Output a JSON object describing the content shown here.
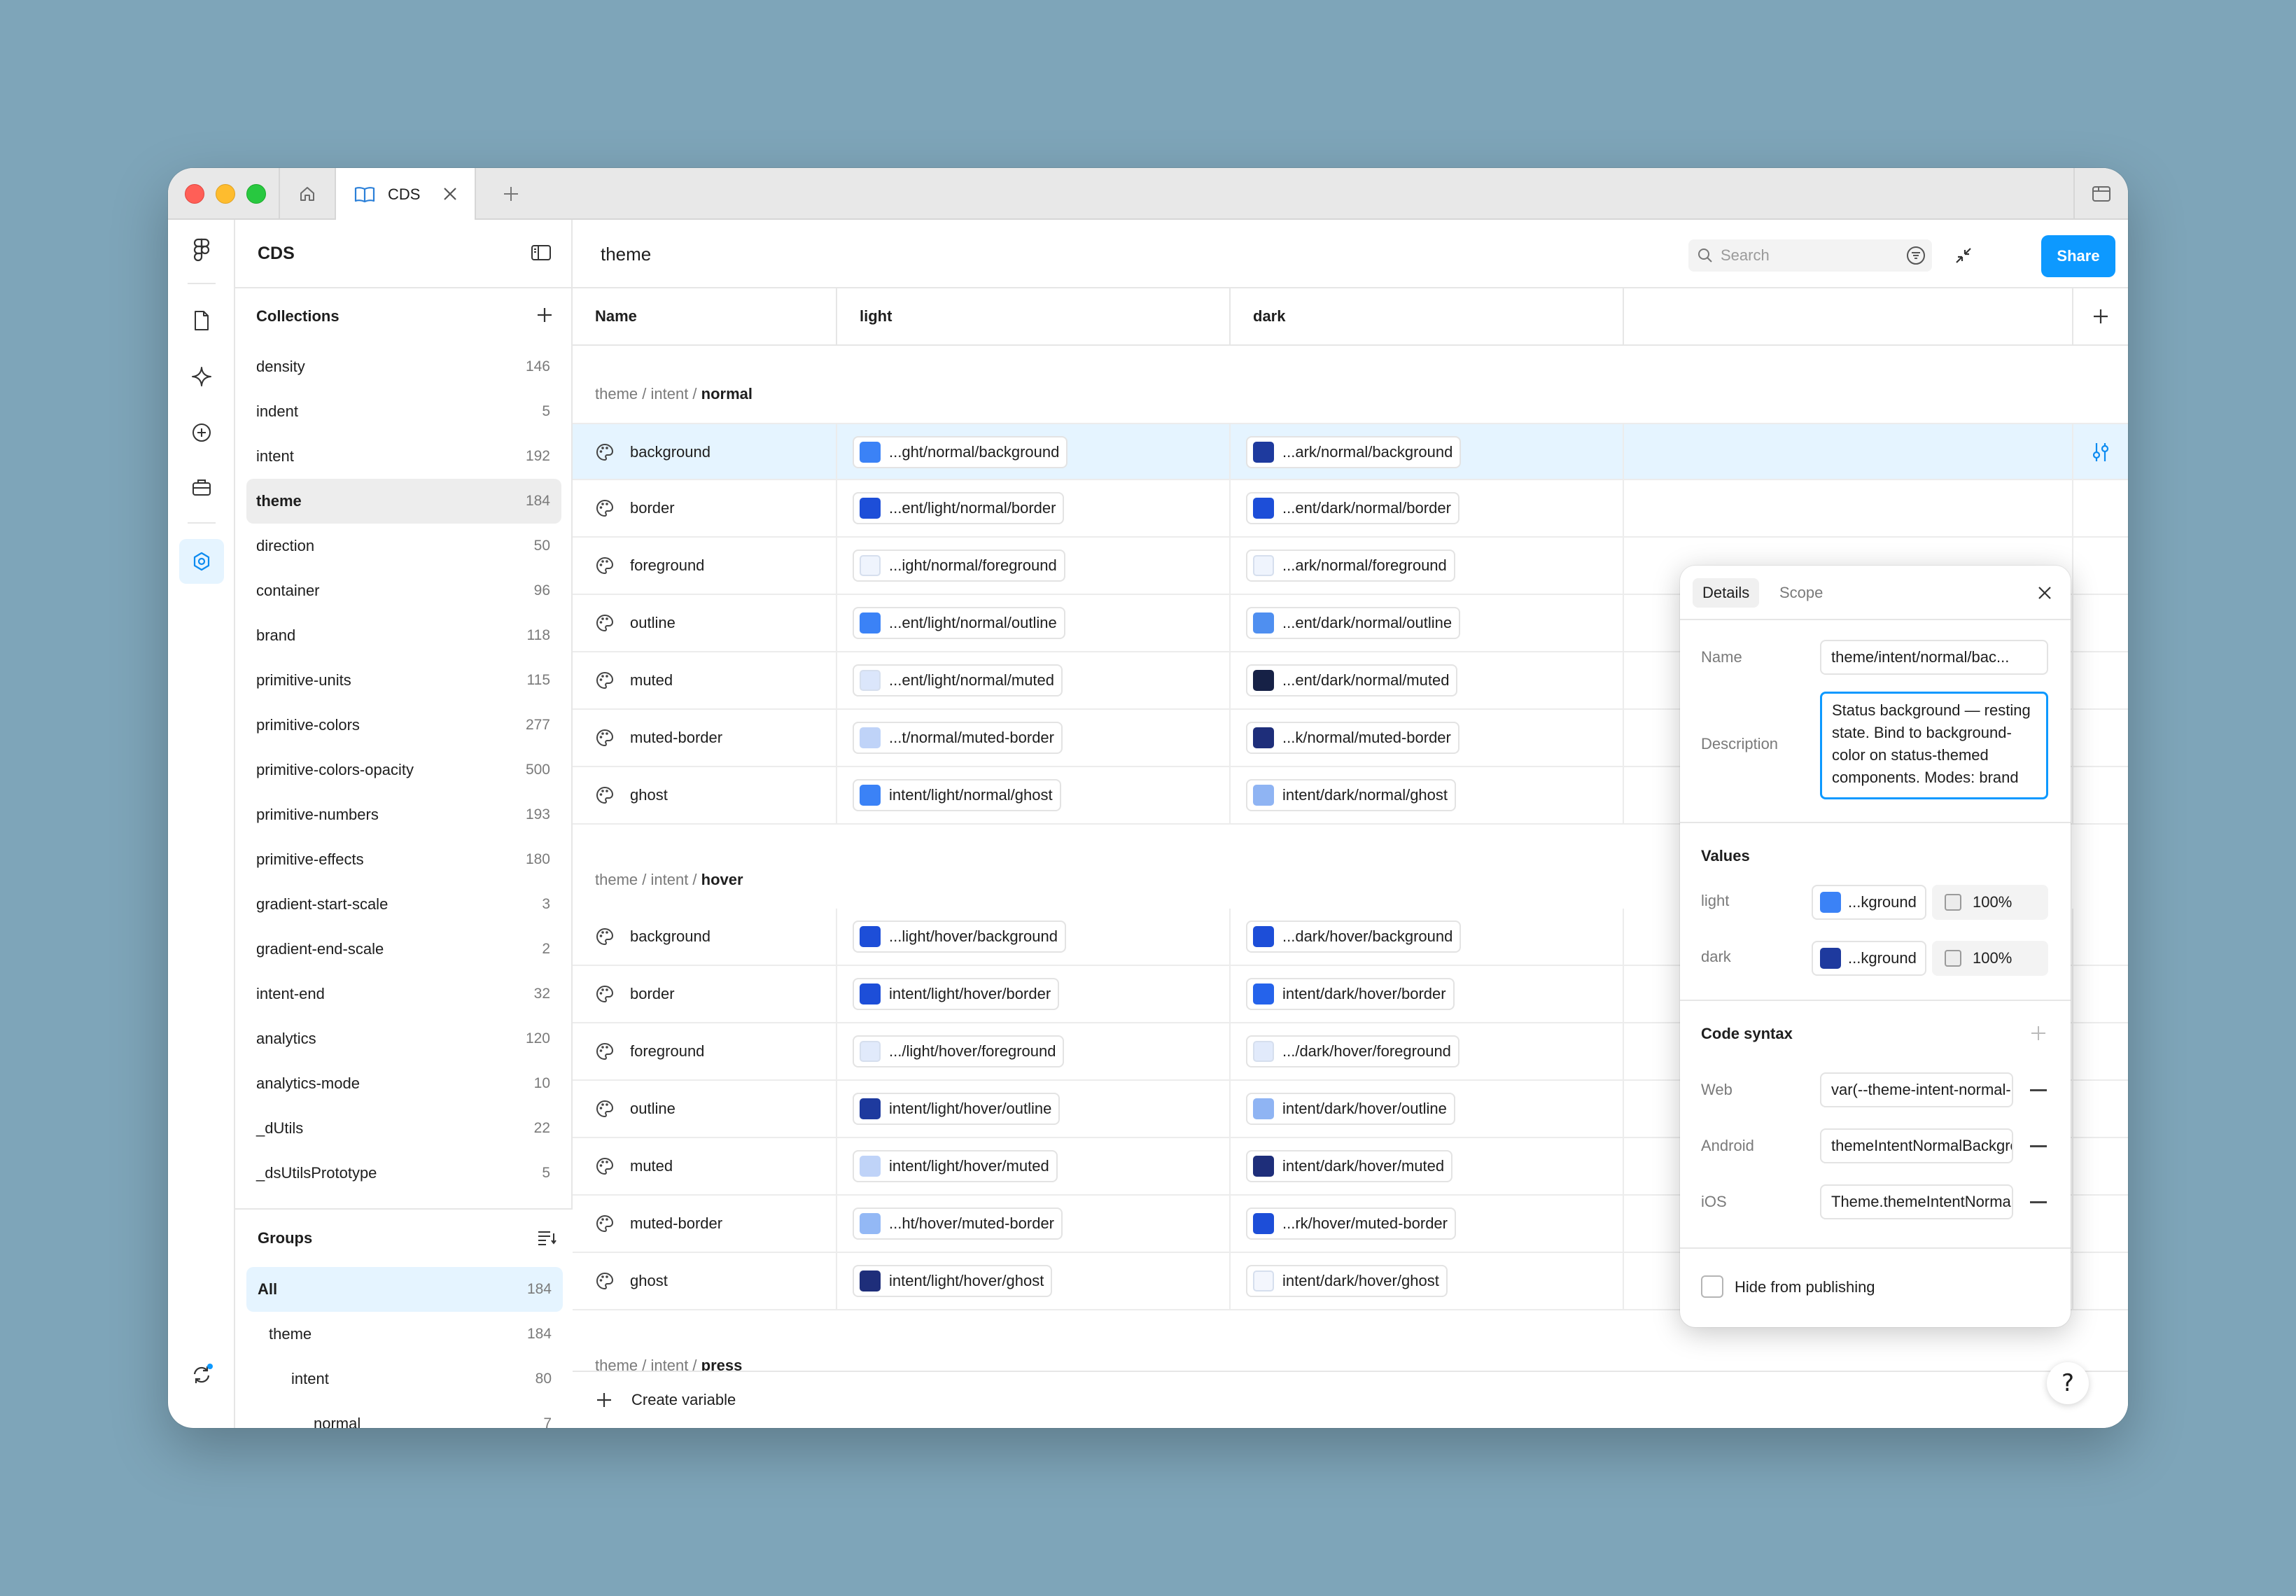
{
  "window": {
    "tab_label": "CDS"
  },
  "sidebar": {
    "title": "CDS",
    "collections_heading": "Collections",
    "collections": [
      {
        "label": "density",
        "count": "146"
      },
      {
        "label": "indent",
        "count": "5"
      },
      {
        "label": "intent",
        "count": "192"
      },
      {
        "label": "theme",
        "count": "184"
      },
      {
        "label": "direction",
        "count": "50"
      },
      {
        "label": "container",
        "count": "96"
      },
      {
        "label": "brand",
        "count": "118"
      },
      {
        "label": "primitive-units",
        "count": "115"
      },
      {
        "label": "primitive-colors",
        "count": "277"
      },
      {
        "label": "primitive-colors-opacity",
        "count": "500"
      },
      {
        "label": "primitive-numbers",
        "count": "193"
      },
      {
        "label": "primitive-effects",
        "count": "180"
      },
      {
        "label": "gradient-start-scale",
        "count": "3"
      },
      {
        "label": "gradient-end-scale",
        "count": "2"
      },
      {
        "label": "intent-end",
        "count": "32"
      },
      {
        "label": "analytics",
        "count": "120"
      },
      {
        "label": "analytics-mode",
        "count": "10"
      },
      {
        "label": "_dUtils",
        "count": "22"
      },
      {
        "label": "_dsUtilsPrototype",
        "count": "5"
      }
    ],
    "selected_collection": "theme",
    "groups_heading": "Groups",
    "groups": [
      {
        "label": "All",
        "count": "184"
      },
      {
        "label": "theme",
        "count": "184"
      },
      {
        "label": "intent",
        "count": "80"
      },
      {
        "label": "normal",
        "count": "7"
      }
    ]
  },
  "main": {
    "title": "theme",
    "search_placeholder": "Search",
    "share_label": "Share",
    "columns": [
      "Name",
      "light",
      "dark"
    ],
    "groups": [
      {
        "path": "theme / intent / ",
        "leaf": "normal",
        "rows": [
          {
            "name": "background",
            "light": {
              "label": "...ght/normal/background",
              "color": "#3b82f6"
            },
            "dark": {
              "label": "...ark/normal/background",
              "color": "#1e3a9e"
            }
          },
          {
            "name": "border",
            "light": {
              "label": "...ent/light/normal/border",
              "color": "#1d4ed8"
            },
            "dark": {
              "label": "...ent/dark/normal/border",
              "color": "#1d4ed8"
            }
          },
          {
            "name": "foreground",
            "light": {
              "label": "...ight/normal/foreground",
              "color": "#eff4fd"
            },
            "dark": {
              "label": "...ark/normal/foreground",
              "color": "#eff4fd"
            }
          },
          {
            "name": "outline",
            "light": {
              "label": "...ent/light/normal/outline",
              "color": "#3b82f6"
            },
            "dark": {
              "label": "...ent/dark/normal/outline",
              "color": "#4f8ff0"
            }
          },
          {
            "name": "muted",
            "light": {
              "label": "...ent/light/normal/muted",
              "color": "#dbe6fb"
            },
            "dark": {
              "label": "...ent/dark/normal/muted",
              "color": "#162146"
            }
          },
          {
            "name": "muted-border",
            "light": {
              "label": "...t/normal/muted-border",
              "color": "#bfd3f8"
            },
            "dark": {
              "label": "...k/normal/muted-border",
              "color": "#1e2e7a"
            }
          },
          {
            "name": "ghost",
            "light": {
              "label": "intent/light/normal/ghost",
              "color": "#3b82f6"
            },
            "dark": {
              "label": "intent/dark/normal/ghost",
              "color": "#8fb4f3"
            }
          }
        ]
      },
      {
        "path": "theme / intent / ",
        "leaf": "hover",
        "rows": [
          {
            "name": "background",
            "light": {
              "label": "...light/hover/background",
              "color": "#1d4ed8"
            },
            "dark": {
              "label": "...dark/hover/background",
              "color": "#1d4ed8"
            }
          },
          {
            "name": "border",
            "light": {
              "label": "intent/light/hover/border",
              "color": "#1d4ed8"
            },
            "dark": {
              "label": "intent/dark/hover/border",
              "color": "#2563eb"
            }
          },
          {
            "name": "foreground",
            "light": {
              "label": ".../light/hover/foreground",
              "color": "#e1eafb"
            },
            "dark": {
              "label": ".../dark/hover/foreground",
              "color": "#e1eafb"
            }
          },
          {
            "name": "outline",
            "light": {
              "label": "intent/light/hover/outline",
              "color": "#1e3a9e"
            },
            "dark": {
              "label": "intent/dark/hover/outline",
              "color": "#8fb4f3"
            }
          },
          {
            "name": "muted",
            "light": {
              "label": "intent/light/hover/muted",
              "color": "#bfd3f8"
            },
            "dark": {
              "label": "intent/dark/hover/muted",
              "color": "#1e2e7a"
            }
          },
          {
            "name": "muted-border",
            "light": {
              "label": "...ht/hover/muted-border",
              "color": "#93b8f5"
            },
            "dark": {
              "label": "...rk/hover/muted-border",
              "color": "#1d4ed8"
            }
          },
          {
            "name": "ghost",
            "light": {
              "label": "intent/light/hover/ghost",
              "color": "#1e2e7a"
            },
            "dark": {
              "label": "intent/dark/hover/ghost",
              "color": "#f3f6fd"
            }
          }
        ]
      },
      {
        "path": "theme / intent / ",
        "leaf": "press",
        "rows": []
      }
    ],
    "create_variable_label": "Create variable",
    "help_label": "?"
  },
  "details_panel": {
    "tabs": [
      "Details",
      "Scope"
    ],
    "name_label": "Name",
    "name_value": "theme/intent/normal/bac...",
    "description_label": "Description",
    "description_value": "Status background — resting state. Bind to background-color on status-themed components. Modes: brand",
    "values_heading": "Values",
    "values": [
      {
        "mode": "light",
        "ref": "...kground",
        "color": "#3b82f6",
        "opacity": "100%"
      },
      {
        "mode": "dark",
        "ref": "...kground",
        "color": "#1e3a9e",
        "opacity": "100%"
      }
    ],
    "code_syntax_heading": "Code syntax",
    "code_syntax": [
      {
        "platform": "Web",
        "value": "var(--theme-intent-normal-background)"
      },
      {
        "platform": "Android",
        "value": "themeIntentNormalBackground"
      },
      {
        "platform": "iOS",
        "value": "Theme.themeIntentNormalBackground"
      }
    ],
    "hide_label": "Hide from publishing"
  }
}
